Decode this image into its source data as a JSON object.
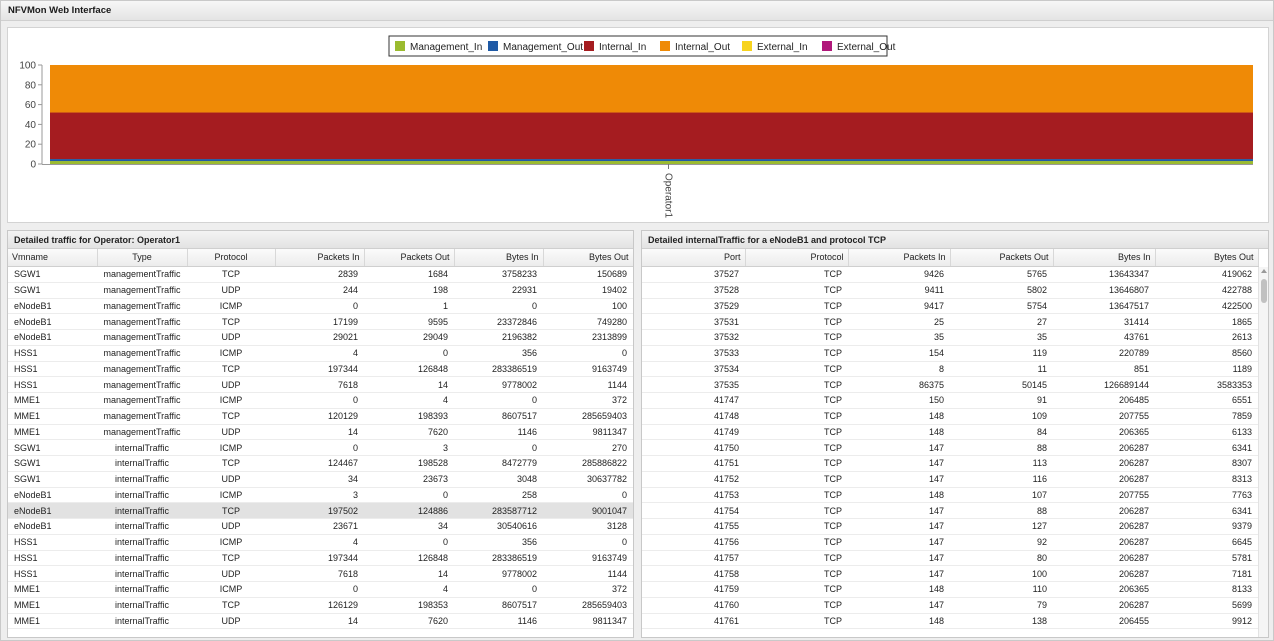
{
  "app": {
    "title": "NFVMon Web Interface"
  },
  "chart_data": {
    "type": "bar",
    "stacked": true,
    "categories": [
      "Operator1"
    ],
    "series": [
      {
        "name": "Management_In",
        "color": "#9bbb2f",
        "values": [
          3
        ]
      },
      {
        "name": "Management_Out",
        "color": "#1f5aa6",
        "values": [
          2
        ]
      },
      {
        "name": "Internal_In",
        "color": "#a51c20",
        "values": [
          47
        ]
      },
      {
        "name": "Internal_Out",
        "color": "#ef8a06",
        "values": [
          48
        ]
      },
      {
        "name": "External_In",
        "color": "#f7d31e",
        "values": [
          0
        ]
      },
      {
        "name": "External_Out",
        "color": "#b0177a",
        "values": [
          0
        ]
      }
    ],
    "yticks": [
      0,
      20,
      40,
      60,
      80,
      100
    ],
    "ylim": [
      0,
      100
    ],
    "legend_position": "top-center",
    "grid": false
  },
  "left_panel": {
    "title": "Detailed traffic for Operator: Operator1",
    "columns": [
      "Vmname",
      "Type",
      "Protocol",
      "Packets In",
      "Packets Out",
      "Bytes In",
      "Bytes Out"
    ],
    "rows": [
      [
        "SGW1",
        "managementTraffic",
        "TCP",
        "2839",
        "1684",
        "3758233",
        "150689"
      ],
      [
        "SGW1",
        "managementTraffic",
        "UDP",
        "244",
        "198",
        "22931",
        "19402"
      ],
      [
        "eNodeB1",
        "managementTraffic",
        "ICMP",
        "0",
        "1",
        "0",
        "100"
      ],
      [
        "eNodeB1",
        "managementTraffic",
        "TCP",
        "17199",
        "9595",
        "23372846",
        "749280"
      ],
      [
        "eNodeB1",
        "managementTraffic",
        "UDP",
        "29021",
        "29049",
        "2196382",
        "2313899"
      ],
      [
        "HSS1",
        "managementTraffic",
        "ICMP",
        "4",
        "0",
        "356",
        "0"
      ],
      [
        "HSS1",
        "managementTraffic",
        "TCP",
        "197344",
        "126848",
        "283386519",
        "9163749"
      ],
      [
        "HSS1",
        "managementTraffic",
        "UDP",
        "7618",
        "14",
        "9778002",
        "1144"
      ],
      [
        "MME1",
        "managementTraffic",
        "ICMP",
        "0",
        "4",
        "0",
        "372"
      ],
      [
        "MME1",
        "managementTraffic",
        "TCP",
        "120129",
        "198393",
        "8607517",
        "285659403"
      ],
      [
        "MME1",
        "managementTraffic",
        "UDP",
        "14",
        "7620",
        "1146",
        "9811347"
      ],
      [
        "SGW1",
        "internalTraffic",
        "ICMP",
        "0",
        "3",
        "0",
        "270"
      ],
      [
        "SGW1",
        "internalTraffic",
        "TCP",
        "124467",
        "198528",
        "8472779",
        "285886822"
      ],
      [
        "SGW1",
        "internalTraffic",
        "UDP",
        "34",
        "23673",
        "3048",
        "30637782"
      ],
      [
        "eNodeB1",
        "internalTraffic",
        "ICMP",
        "3",
        "0",
        "258",
        "0"
      ],
      [
        "eNodeB1",
        "internalTraffic",
        "TCP",
        "197502",
        "124886",
        "283587712",
        "9001047"
      ],
      [
        "eNodeB1",
        "internalTraffic",
        "UDP",
        "23671",
        "34",
        "30540616",
        "3128"
      ],
      [
        "HSS1",
        "internalTraffic",
        "ICMP",
        "4",
        "0",
        "356",
        "0"
      ],
      [
        "HSS1",
        "internalTraffic",
        "TCP",
        "197344",
        "126848",
        "283386519",
        "9163749"
      ],
      [
        "HSS1",
        "internalTraffic",
        "UDP",
        "7618",
        "14",
        "9778002",
        "1144"
      ],
      [
        "MME1",
        "internalTraffic",
        "ICMP",
        "0",
        "4",
        "0",
        "372"
      ],
      [
        "MME1",
        "internalTraffic",
        "TCP",
        "126129",
        "198353",
        "8607517",
        "285659403"
      ],
      [
        "MME1",
        "internalTraffic",
        "UDP",
        "14",
        "7620",
        "1146",
        "9811347"
      ]
    ],
    "selected_row": 15
  },
  "right_panel": {
    "title": "Detailed internalTraffic for a eNodeB1 and protocol TCP",
    "columns": [
      "Port",
      "Protocol",
      "Packets In",
      "Packets Out",
      "Bytes In",
      "Bytes Out"
    ],
    "rows": [
      [
        "37527",
        "TCP",
        "9426",
        "5765",
        "13643347",
        "419062"
      ],
      [
        "37528",
        "TCP",
        "9411",
        "5802",
        "13646807",
        "422788"
      ],
      [
        "37529",
        "TCP",
        "9417",
        "5754",
        "13647517",
        "422500"
      ],
      [
        "37531",
        "TCP",
        "25",
        "27",
        "31414",
        "1865"
      ],
      [
        "37532",
        "TCP",
        "35",
        "35",
        "43761",
        "2613"
      ],
      [
        "37533",
        "TCP",
        "154",
        "119",
        "220789",
        "8560"
      ],
      [
        "37534",
        "TCP",
        "8",
        "11",
        "851",
        "1189"
      ],
      [
        "37535",
        "TCP",
        "86375",
        "50145",
        "126689144",
        "3583353"
      ],
      [
        "41747",
        "TCP",
        "150",
        "91",
        "206485",
        "6551"
      ],
      [
        "41748",
        "TCP",
        "148",
        "109",
        "207755",
        "7859"
      ],
      [
        "41749",
        "TCP",
        "148",
        "84",
        "206365",
        "6133"
      ],
      [
        "41750",
        "TCP",
        "147",
        "88",
        "206287",
        "6341"
      ],
      [
        "41751",
        "TCP",
        "147",
        "113",
        "206287",
        "8307"
      ],
      [
        "41752",
        "TCP",
        "147",
        "116",
        "206287",
        "8313"
      ],
      [
        "41753",
        "TCP",
        "148",
        "107",
        "207755",
        "7763"
      ],
      [
        "41754",
        "TCP",
        "147",
        "88",
        "206287",
        "6341"
      ],
      [
        "41755",
        "TCP",
        "147",
        "127",
        "206287",
        "9379"
      ],
      [
        "41756",
        "TCP",
        "147",
        "92",
        "206287",
        "6645"
      ],
      [
        "41757",
        "TCP",
        "147",
        "80",
        "206287",
        "5781"
      ],
      [
        "41758",
        "TCP",
        "147",
        "100",
        "206287",
        "7181"
      ],
      [
        "41759",
        "TCP",
        "148",
        "110",
        "206365",
        "8133"
      ],
      [
        "41760",
        "TCP",
        "147",
        "79",
        "206287",
        "5699"
      ],
      [
        "41761",
        "TCP",
        "148",
        "138",
        "206455",
        "9912"
      ]
    ]
  }
}
